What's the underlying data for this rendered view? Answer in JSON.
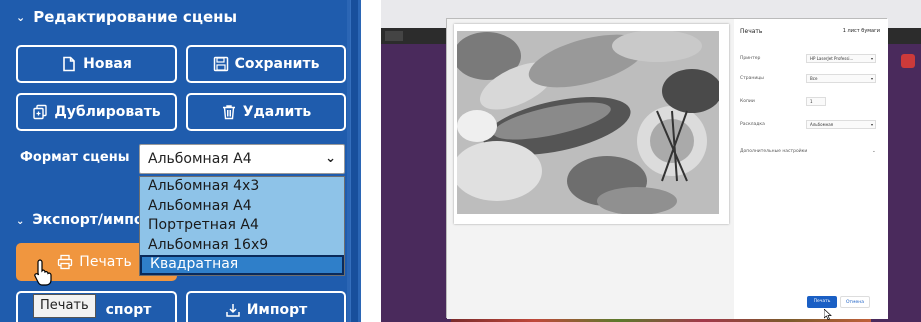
{
  "left": {
    "scene_section_title": "Редактирование сцены",
    "buttons": {
      "new": "Новая",
      "save": "Сохранить",
      "duplicate": "Дублировать",
      "delete": "Удалить",
      "print": "Печать",
      "export": "спорт",
      "import": "Импорт"
    },
    "format_label": "Формат сцены",
    "format_selected": "Альбомная А4",
    "format_options": [
      "Альбомная 4x3",
      "Альбомная А4",
      "Портретная А4",
      "Альбомная 16x9",
      "Квадратная"
    ],
    "format_highlighted_option": "Квадратная",
    "export_section_title": "Экспорт/импо",
    "tooltip": "Печать"
  },
  "right": {
    "print_dialog": {
      "title": "Печать",
      "sheets": "1 лист бумаги",
      "rows": [
        {
          "label": "Принтер",
          "value": "HP LaserJet Professi..."
        },
        {
          "label": "Страницы",
          "value": "Все"
        },
        {
          "label": "Копии",
          "value": "1"
        },
        {
          "label": "Раскладка",
          "value": "Альбомная"
        }
      ],
      "more_settings": "Дополнительные настройки",
      "print_button": "Печать",
      "cancel_button": "Отмена"
    }
  },
  "colors": {
    "left_bg": "#1f5cad",
    "print_button": "#f0963f",
    "dropdown_bg": "#8ec3e8",
    "dropdown_selected": "#2f7fc9"
  }
}
